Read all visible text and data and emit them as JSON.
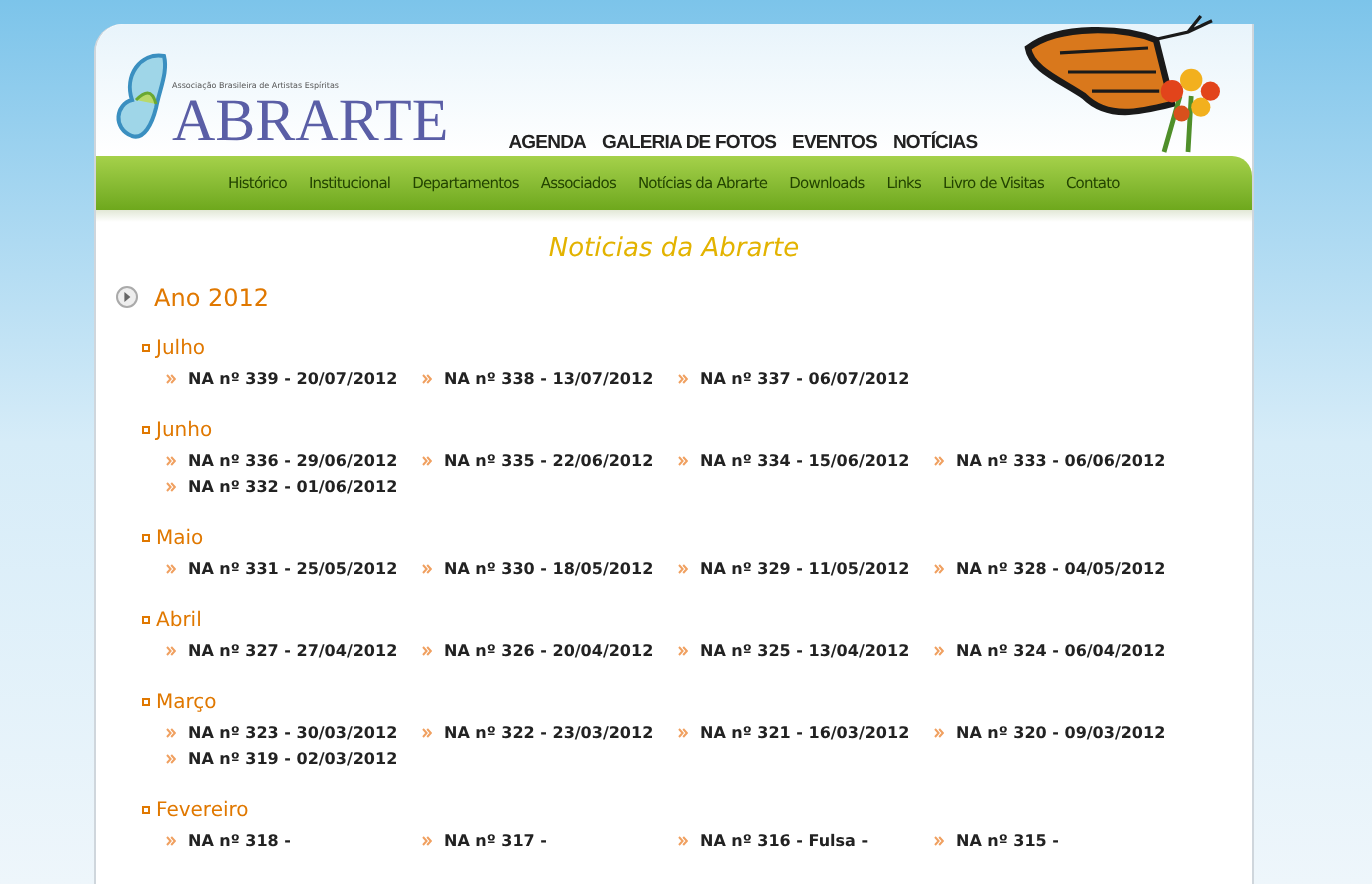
{
  "header": {
    "logo": {
      "tagline": "Associação Brasileira de Artistas Espíritas",
      "name": "ABRARTE"
    },
    "top_nav": [
      "AGENDA",
      "GALERIA DE FOTOS",
      "EVENTOS",
      "NOTÍCIAS"
    ],
    "main_nav": [
      "Histórico",
      "Institucional",
      "Departamentos",
      "Associados",
      "Notícias da Abrarte",
      "Downloads",
      "Links",
      "Livro de Visitas",
      "Contato"
    ]
  },
  "page_title": "Noticias da Abrarte",
  "years": [
    {
      "label": "Ano 2012",
      "months": [
        {
          "label": "Julho",
          "items": [
            "NA nº 339 - 20/07/2012",
            "NA nº 338 - 13/07/2012",
            "NA nº 337 - 06/07/2012"
          ]
        },
        {
          "label": "Junho",
          "items": [
            "NA nº 336 - 29/06/2012",
            "NA nº 335 - 22/06/2012",
            "NA nº 334 - 15/06/2012",
            "NA nº 333 - 06/06/2012",
            "NA nº 332 - 01/06/2012"
          ]
        },
        {
          "label": "Maio",
          "items": [
            "NA nº 331 - 25/05/2012",
            "NA nº 330 - 18/05/2012",
            "NA nº 329 - 11/05/2012",
            "NA nº 328 - 04/05/2012"
          ]
        },
        {
          "label": "Abril",
          "items": [
            "NA nº 327 - 27/04/2012",
            "NA nº 326 - 20/04/2012",
            "NA nº 325 - 13/04/2012",
            "NA nº 324 - 06/04/2012"
          ]
        },
        {
          "label": "Março",
          "items": [
            "NA nº 323 - 30/03/2012",
            "NA nº 322 - 23/03/2012",
            "NA nº 321 - 16/03/2012",
            "NA nº 320 - 09/03/2012",
            "NA nº 319 - 02/03/2012"
          ]
        },
        {
          "label": "Fevereiro",
          "items": [
            "NA nº 318 -",
            "NA nº 317 -",
            "NA nº 316 - Fulsa -",
            "NA nº 315 -"
          ]
        }
      ]
    }
  ]
}
